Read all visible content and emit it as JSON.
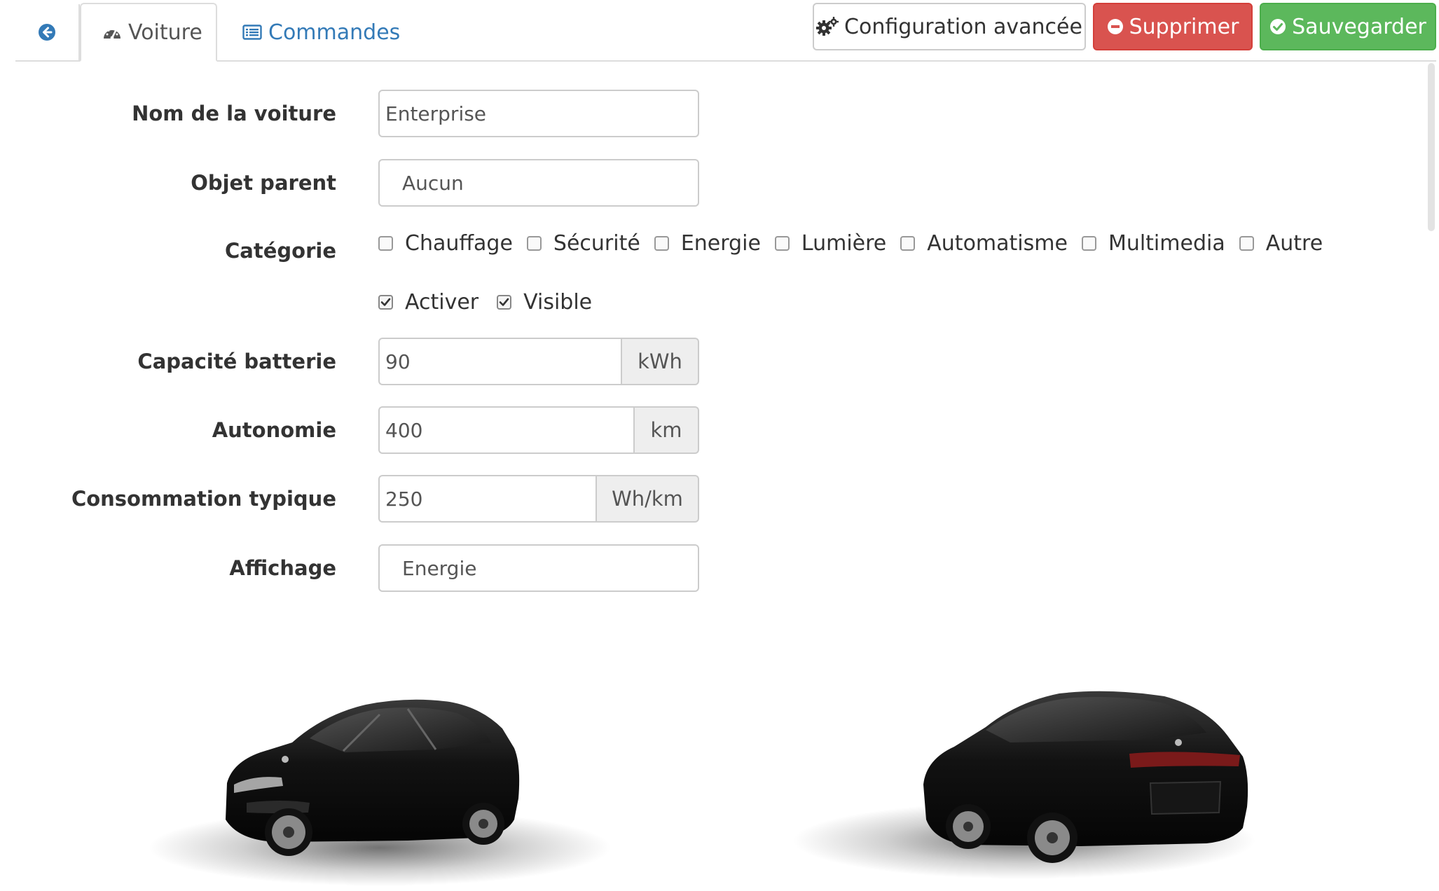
{
  "tabs": {
    "voiture": "Voiture",
    "commandes": "Commandes"
  },
  "actions": {
    "config": "Configuration avancée",
    "delete": "Supprimer",
    "save": "Sauvegarder"
  },
  "form": {
    "name": {
      "label": "Nom de la voiture",
      "value": "Enterprise"
    },
    "parent": {
      "label": "Objet parent",
      "value": "Aucun"
    },
    "category": {
      "label": "Catégorie",
      "options": [
        {
          "label": "Chauffage",
          "checked": false
        },
        {
          "label": "Sécurité",
          "checked": false
        },
        {
          "label": "Energie",
          "checked": false
        },
        {
          "label": "Lumière",
          "checked": false
        },
        {
          "label": "Automatisme",
          "checked": false
        },
        {
          "label": "Multimedia",
          "checked": false
        },
        {
          "label": "Autre",
          "checked": false
        }
      ]
    },
    "activate": {
      "label": "Activer",
      "checked": true
    },
    "visible": {
      "label": "Visible",
      "checked": true
    },
    "battery": {
      "label": "Capacité batterie",
      "value": "90",
      "unit": "kWh"
    },
    "range": {
      "label": "Autonomie",
      "value": "400",
      "unit": "km"
    },
    "consumption": {
      "label": "Consommation typique",
      "value": "250",
      "unit": "Wh/km"
    },
    "display": {
      "label": "Affichage",
      "value": "Energie"
    }
  },
  "colors": {
    "link": "#337ab7",
    "danger": "#d9534f",
    "success": "#5cb85c"
  }
}
